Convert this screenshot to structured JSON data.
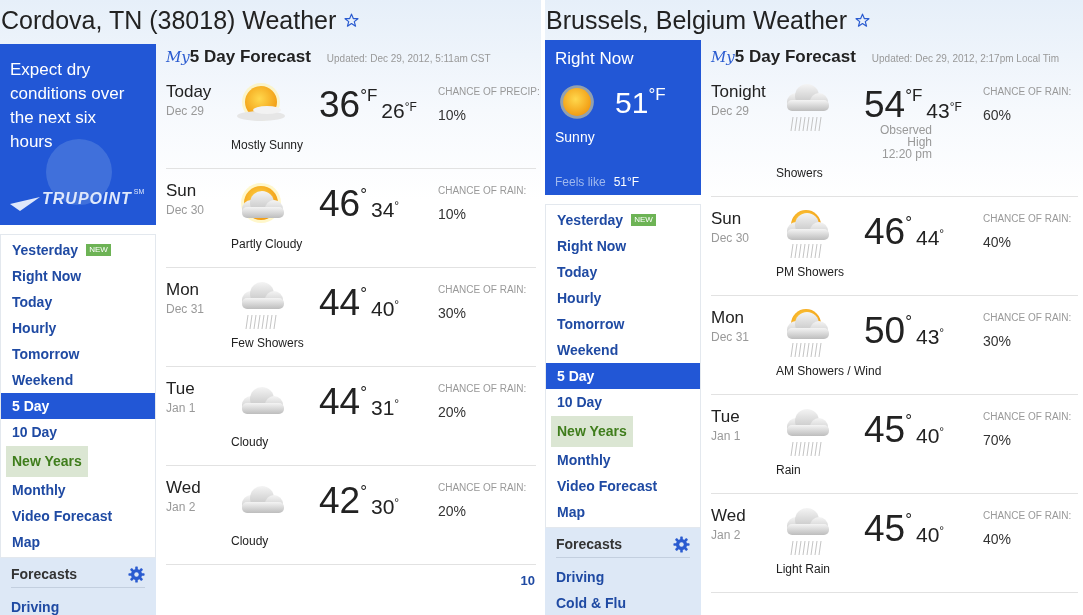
{
  "pages": [
    {
      "title": "Cordova, TN (38018) Weather",
      "promo": {
        "kind": "alert",
        "text": "Expect dry conditions over the next six hours",
        "logo": "TRUPOINT",
        "logo_mark": "SM"
      },
      "nav": [
        {
          "label": "Yesterday",
          "kind": "link",
          "badge": "NEW",
          "selected": false
        },
        {
          "label": "Right Now",
          "kind": "link",
          "selected": false
        },
        {
          "label": "Today",
          "kind": "link",
          "selected": false
        },
        {
          "label": "Hourly",
          "kind": "link",
          "selected": false
        },
        {
          "label": "Tomorrow",
          "kind": "link",
          "selected": false
        },
        {
          "label": "Weekend",
          "kind": "link",
          "selected": false
        },
        {
          "label": "5 Day",
          "kind": "link",
          "selected": true
        },
        {
          "label": "10 Day",
          "kind": "link",
          "selected": false
        },
        {
          "label": "New Years",
          "kind": "holiday",
          "selected": false
        },
        {
          "label": "Monthly",
          "kind": "link",
          "selected": false
        },
        {
          "label": "Video Forecast",
          "kind": "link",
          "selected": false
        },
        {
          "label": "Map",
          "kind": "link",
          "selected": false
        }
      ],
      "nav_section": {
        "title": "Forecasts",
        "items": [
          "Driving"
        ]
      },
      "forecast": {
        "brand": "My",
        "title": "5 Day Forecast",
        "updated": "Updated: Dec 29, 2012, 5:11am CST",
        "days": [
          {
            "day": "Today",
            "date": "Dec 29",
            "kind": "mostly-sunny",
            "condition": "Mostly Sunny",
            "high": "36",
            "high_unit": "°F",
            "low": "26",
            "low_unit": "°F",
            "chance_label": "CHANCE OF PRECIP:",
            "chance": "10%"
          },
          {
            "day": "Sun",
            "date": "Dec 30",
            "kind": "partly-cloudy",
            "condition": "Partly Cloudy",
            "high": "46",
            "high_unit": "°",
            "low": "34",
            "low_unit": "°",
            "chance_label": "CHANCE OF RAIN:",
            "chance": "10%"
          },
          {
            "day": "Mon",
            "date": "Dec 31",
            "kind": "showers",
            "condition": "Few Showers",
            "high": "44",
            "high_unit": "°",
            "low": "40",
            "low_unit": "°",
            "chance_label": "CHANCE OF RAIN:",
            "chance": "30%"
          },
          {
            "day": "Tue",
            "date": "Jan 1",
            "kind": "cloudy",
            "condition": "Cloudy",
            "high": "44",
            "high_unit": "°",
            "low": "31",
            "low_unit": "°",
            "chance_label": "CHANCE OF RAIN:",
            "chance": "20%"
          },
          {
            "day": "Wed",
            "date": "Jan 2",
            "kind": "cloudy",
            "condition": "Cloudy",
            "high": "42",
            "high_unit": "°",
            "low": "30",
            "low_unit": "°",
            "chance_label": "CHANCE OF RAIN:",
            "chance": "20%"
          }
        ]
      },
      "footer_link": "10"
    },
    {
      "title": "Brussels, Belgium Weather",
      "promo": {
        "kind": "current",
        "heading": "Right Now",
        "temp": "51",
        "temp_unit": "°F",
        "condition": "Sunny",
        "feels_label": "Feels like",
        "feels": "51°F"
      },
      "nav": [
        {
          "label": "Yesterday",
          "kind": "link",
          "badge": "NEW",
          "selected": false
        },
        {
          "label": "Right Now",
          "kind": "link",
          "selected": false
        },
        {
          "label": "Today",
          "kind": "link",
          "selected": false
        },
        {
          "label": "Hourly",
          "kind": "link",
          "selected": false
        },
        {
          "label": "Tomorrow",
          "kind": "link",
          "selected": false
        },
        {
          "label": "Weekend",
          "kind": "link",
          "selected": false
        },
        {
          "label": "5 Day",
          "kind": "link",
          "selected": true
        },
        {
          "label": "10 Day",
          "kind": "link",
          "selected": false
        },
        {
          "label": "New Years",
          "kind": "holiday",
          "selected": false
        },
        {
          "label": "Monthly",
          "kind": "link",
          "selected": false
        },
        {
          "label": "Video Forecast",
          "kind": "link",
          "selected": false
        },
        {
          "label": "Map",
          "kind": "link",
          "selected": false
        }
      ],
      "nav_section": {
        "title": "Forecasts",
        "items": [
          "Driving",
          "Cold & Flu"
        ]
      },
      "forecast": {
        "brand": "My",
        "title": "5 Day Forecast",
        "updated": "Updated: Dec 29, 2012, 2:17pm Local Tim",
        "days": [
          {
            "day": "Tonight",
            "date": "Dec 29",
            "kind": "showers",
            "condition": "Showers",
            "high": "54",
            "high_unit": "°F",
            "low": "43",
            "low_unit": "°F",
            "observed": [
              "Observed",
              "High",
              "12:20 pm"
            ],
            "chance_label": "CHANCE OF RAIN:",
            "chance": "60%"
          },
          {
            "day": "Sun",
            "date": "Dec 30",
            "kind": "sun-showers",
            "condition": "PM Showers",
            "high": "46",
            "high_unit": "°",
            "low": "44",
            "low_unit": "°",
            "chance_label": "CHANCE OF RAIN:",
            "chance": "40%"
          },
          {
            "day": "Mon",
            "date": "Dec 31",
            "kind": "sun-showers",
            "condition": "AM Showers / Wind",
            "high": "50",
            "high_unit": "°",
            "low": "43",
            "low_unit": "°",
            "chance_label": "CHANCE OF RAIN:",
            "chance": "30%"
          },
          {
            "day": "Tue",
            "date": "Jan 1",
            "kind": "showers",
            "condition": "Rain",
            "high": "45",
            "high_unit": "°",
            "low": "40",
            "low_unit": "°",
            "chance_label": "CHANCE OF RAIN:",
            "chance": "70%"
          },
          {
            "day": "Wed",
            "date": "Jan 2",
            "kind": "showers",
            "condition": "Light Rain",
            "high": "45",
            "high_unit": "°",
            "low": "40",
            "low_unit": "°",
            "chance_label": "CHANCE OF RAIN:",
            "chance": "40%"
          }
        ]
      }
    }
  ]
}
